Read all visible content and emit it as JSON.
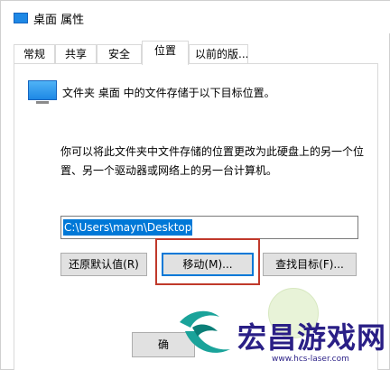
{
  "window": {
    "title": "桌面 属性"
  },
  "tabs": [
    {
      "label": "常规"
    },
    {
      "label": "共享"
    },
    {
      "label": "安全"
    },
    {
      "label": "位置",
      "active": true
    },
    {
      "label": "以前的版..."
    }
  ],
  "location": {
    "folder_description": "文件夹 桌面 中的文件存储于以下目标位置。",
    "info_text": "你可以将此文件夹中文件存储的位置更改为此硬盘上的另一个位置、另一个驱动器或网络上的另一台计算机。",
    "path_value": "C:\\Users\\mayn\\Desktop",
    "restore_default_label": "还原默认值(R)",
    "move_label": "移动(M)...",
    "find_target_label": "查找目标(F)...",
    "ok_label": "确"
  },
  "watermark": {
    "brand_text": "宏昌游戏网",
    "url": "www.hcs-laser.com"
  },
  "colors": {
    "selection": "#0078d7",
    "highlight_box": "#c0392b",
    "watermark_text": "#2a1f86"
  },
  "icons": {
    "title_icon": "desktop-folder-icon",
    "folder_icon": "desktop-folder-icon"
  }
}
